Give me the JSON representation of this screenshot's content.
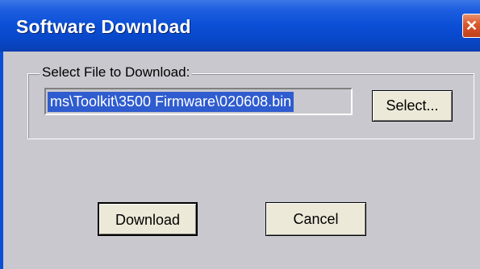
{
  "window": {
    "title": "Software Download",
    "close_glyph": "✕",
    "close_icon": "close-icon"
  },
  "file_group": {
    "legend": "Select File to Download:",
    "path_value": "ms\\Toolkit\\3500 Firmware\\020608.bin",
    "select_label": "Select..."
  },
  "actions": {
    "download_label": "Download",
    "cancel_label": "Cancel"
  },
  "colors": {
    "titlebar": "#0a4fd6",
    "dialog_bg": "#c9c8cf",
    "selection": "#2f5ccf",
    "close_button": "#d9572a"
  }
}
